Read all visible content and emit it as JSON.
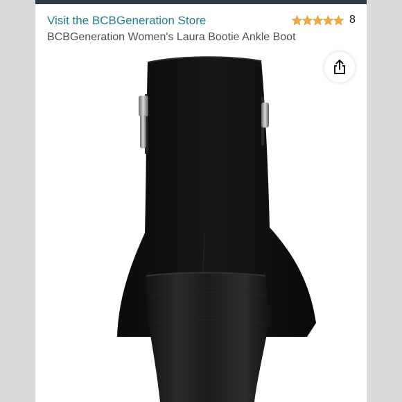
{
  "store": {
    "link_label": "Visit the BCBGeneration Store"
  },
  "rating": {
    "stars": 5,
    "count": "8",
    "star_color": "#f3a847"
  },
  "product": {
    "title": "BCBGeneration Women's Laura Bootie Ankle Boot",
    "image_icon": "black-suede-ankle-boot-back-view"
  },
  "share": {
    "icon": "share-icon"
  },
  "colors": {
    "link": "#1f7e8d",
    "title": "#4b4f54",
    "page_background": "#d9dadb",
    "header_bar": "#2f3a46"
  }
}
